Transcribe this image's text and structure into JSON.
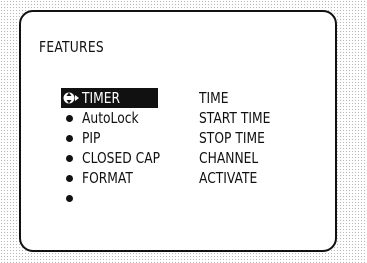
{
  "menu": {
    "title": "FEATURES",
    "items": [
      {
        "label": "TIMER",
        "selected": true
      },
      {
        "label": "AutoLock"
      },
      {
        "label": "PIP"
      },
      {
        "label": "CLOSED CAP"
      },
      {
        "label": "FORMAT"
      },
      {
        "label": ""
      }
    ],
    "subitems": [
      "TIME",
      "START TIME",
      "STOP TIME",
      "CHANNEL",
      "ACTIVATE"
    ]
  }
}
